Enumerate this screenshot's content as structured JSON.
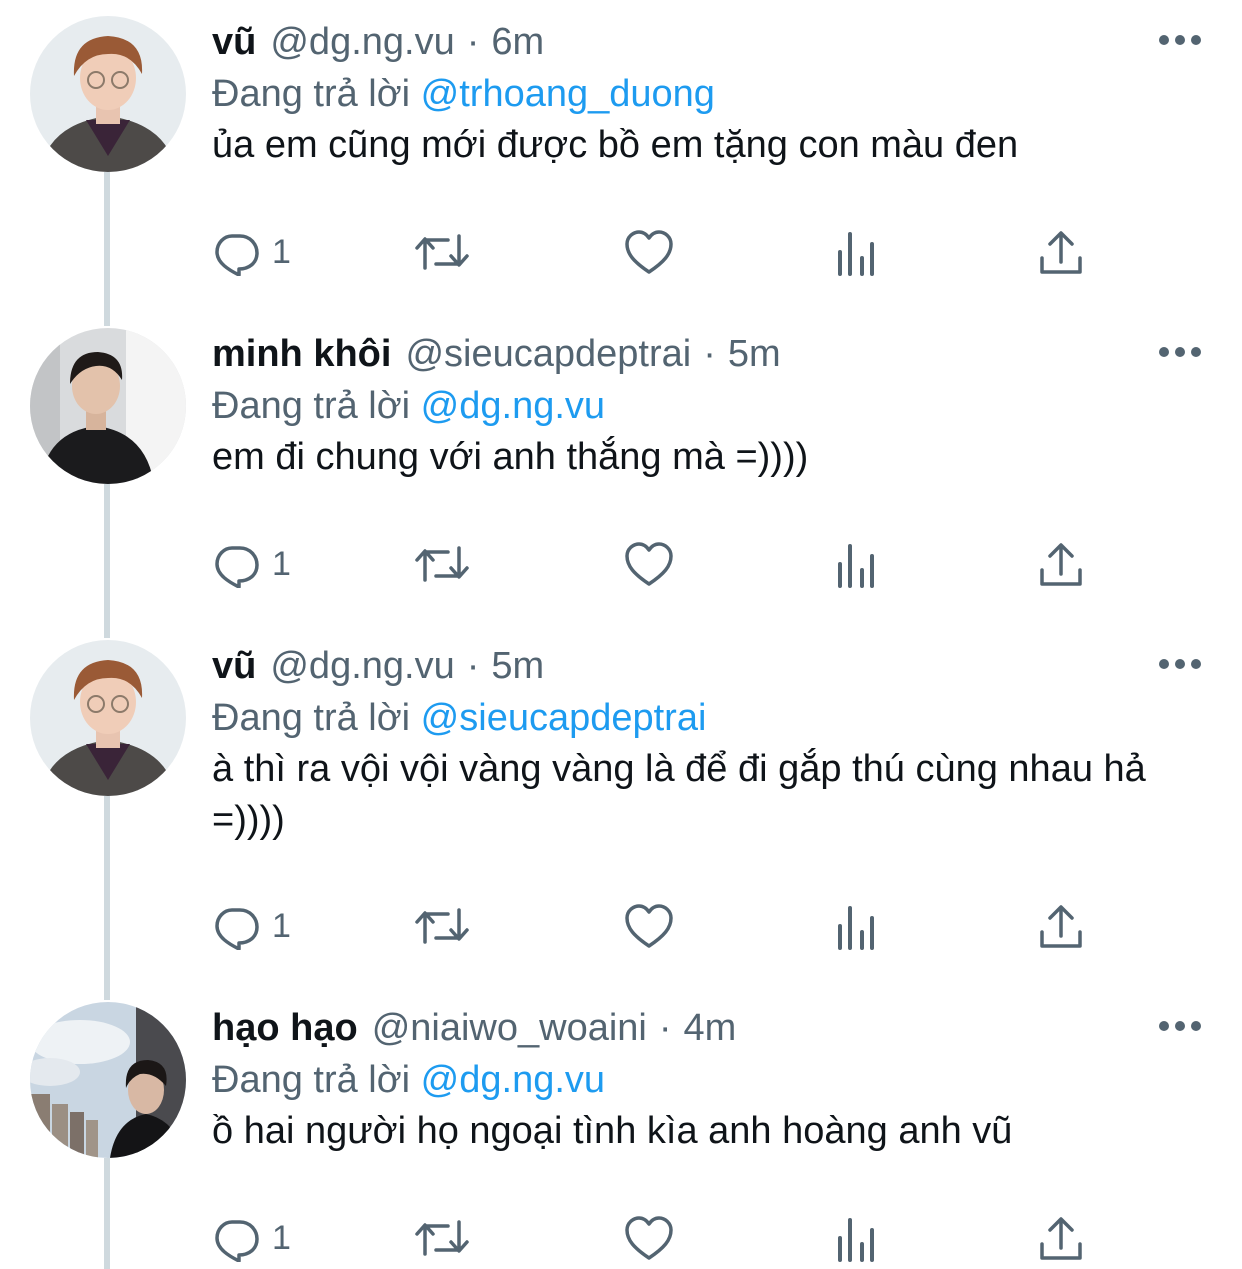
{
  "tweets": [
    {
      "name": "vũ",
      "handle": "@dg.ng.vu",
      "separator": "·",
      "time": "6m",
      "reply_prefix": "Đang trả lời",
      "reply_to": "@trhoang_duong",
      "text": "ủa em cũng mới được bồ em tặng con màu đen",
      "reply_count": "1",
      "avatar": "avatar-vu"
    },
    {
      "name": "minh khôi",
      "handle": "@sieucapdeptrai",
      "separator": "·",
      "time": "5m",
      "reply_prefix": "Đang trả lời",
      "reply_to": "@dg.ng.vu",
      "text": "em đi chung với anh thắng mà =))))",
      "reply_count": "1",
      "avatar": "avatar-minh-khoi"
    },
    {
      "name": "vũ",
      "handle": "@dg.ng.vu",
      "separator": "·",
      "time": "5m",
      "reply_prefix": "Đang trả lời",
      "reply_to": "@sieucapdeptrai",
      "text": "à thì ra vội vội vàng vàng là để đi gắp thú cùng nhau hả =))))",
      "reply_count": "1",
      "avatar": "avatar-vu"
    },
    {
      "name": "hạo hạo",
      "handle": "@niaiwo_woaini",
      "separator": "·",
      "time": "4m",
      "reply_prefix": "Đang trả lời",
      "reply_to": "@dg.ng.vu",
      "text": "ồ hai người họ ngoại tình kìa anh hoàng anh vũ",
      "reply_count": "1",
      "avatar": "avatar-hao-hao"
    }
  ],
  "icons": {
    "more": "more-options-icon",
    "reply": "reply-icon",
    "retweet": "retweet-icon",
    "like": "like-icon",
    "views": "views-icon",
    "share": "share-icon"
  },
  "colors": {
    "text": "#0f1419",
    "secondary": "#536471",
    "link": "#1d9bf0",
    "thread_line": "#cfd9de"
  }
}
